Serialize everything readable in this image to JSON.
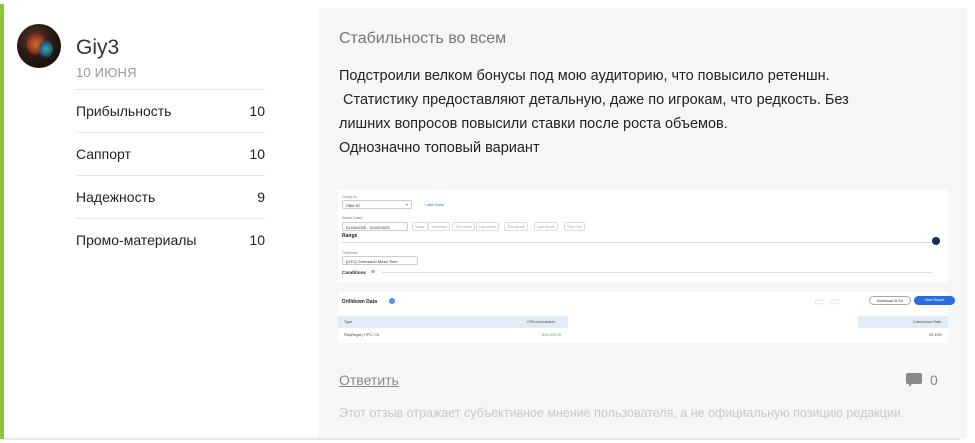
{
  "review": {
    "author": "Giy3",
    "date": "10 июня",
    "ratings": [
      {
        "label": "Прибыльность",
        "value": "10"
      },
      {
        "label": "Саппорт",
        "value": "10"
      },
      {
        "label": "Надежность",
        "value": "9"
      },
      {
        "label": "Промо-материалы",
        "value": "10"
      }
    ],
    "title": "Стабильность во всем",
    "lines": [
      "Подстроили велком бонусы под мою аудиторию, что повысило ретеншн.",
      " Статистику предоставляют детальную, даже по игрокам, что редкость. Без",
      "лишних вопросов повысили ставки после роста объемов.",
      "Однозначно топовый вариант"
    ],
    "reply_label": "Ответить",
    "comment_count": "0",
    "disclaimer": "Этот отзыв отражает субъективное мнение пользователя, а не официальную позицию редакции."
  },
  "colors": {
    "accent": "#8cc63f",
    "panel_bg": "#f6f6f6",
    "link_blue": "#2b6de0"
  },
  "screenshot": {
    "group_label": "Group #1",
    "group_value": "Offer ID",
    "add_group": "+ add Group",
    "select_dates_label": "Select Dates",
    "date_range": "01/04/2025 - 01/05/2025",
    "chips": [
      "Today",
      "Yesterday",
      "This Week",
      "Last Week",
      "This Month",
      "Last Month",
      "This Year"
    ],
    "range_label": "Range",
    "timezone_label": "Timezone",
    "timezone_value": "[UTC] Greenwich Mean Time",
    "conditions_label": "Conditions",
    "drilldown_label": "Drilldown Data",
    "download_btn": "Download XLSX",
    "view_btn": "View Report",
    "col_type": "Type",
    "col_cpa": "CPA commission",
    "col_conversion": "Conversion Rate",
    "row_type": "PlayRegal | PPC / 01",
    "row_cpa": "825,609.00",
    "row_conversion": "29.13%"
  }
}
